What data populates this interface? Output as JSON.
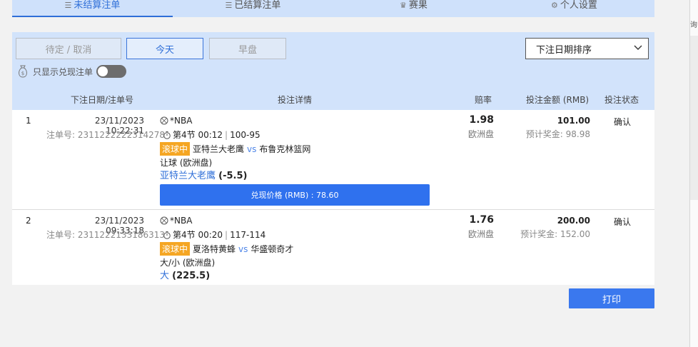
{
  "tabs": [
    {
      "label": "未结算注单",
      "icon": "list-icon",
      "active": true
    },
    {
      "label": "已结算注单",
      "icon": "list-icon",
      "active": false
    },
    {
      "label": "赛果",
      "icon": "trophy-icon",
      "active": false
    },
    {
      "label": "个人设置",
      "icon": "gear-icon",
      "active": false
    }
  ],
  "filter": {
    "pending_label": "待定 / 取消",
    "today_label": "今天",
    "early_label": "早盘",
    "sort_label": "下注日期排序",
    "cashout_only_label": "只显示兑现注单"
  },
  "table": {
    "headers": {
      "date": "下注日期/注单号",
      "detail": "投注详情",
      "odds": "赔率",
      "amount": "投注金额 (RMB)",
      "status": "投注状态"
    },
    "rows": [
      {
        "index": "1",
        "date": "23/11/2023 10:22:31",
        "order_no": "注单号: 2311222222314278",
        "league": "*NBA",
        "period": "第4节 00:12",
        "score": "100-95",
        "live_badge": "滚球中",
        "home": "亚特兰大老鹰",
        "vs": "vs",
        "away": "布鲁克林篮网",
        "market": "让球 (欧洲盘)",
        "selection": "亚特兰大老鹰",
        "handicap": "(-5.5)",
        "cashout_label": "兑现价格 (RMB) : 78.60",
        "odds": "1.98",
        "odds_type": "欧洲盘",
        "amount": "101.00",
        "potential_win": "预计奖金: 98.98",
        "status": "确认"
      },
      {
        "index": "2",
        "date": "23/11/2023 09:33:18",
        "order_no": "注单号: 2311222133186313",
        "league": "*NBA",
        "period": "第4节 00:20",
        "score": "117-114",
        "live_badge": "滚球中",
        "home": "夏洛特黄蜂",
        "vs": "vs",
        "away": "华盛顿奇才",
        "market": "大/小 (欧洲盘)",
        "selection": "大",
        "handicap": "(225.5)",
        "odds": "1.76",
        "odds_type": "欧洲盘",
        "amount": "200.00",
        "potential_win": "预计奖金: 152.00",
        "status": "确认"
      }
    ]
  },
  "print_label": "打印",
  "edge_text": "询",
  "colors": {
    "accent": "#2f71ee",
    "live": "#f5a623",
    "panel": "#d2e3fb"
  }
}
